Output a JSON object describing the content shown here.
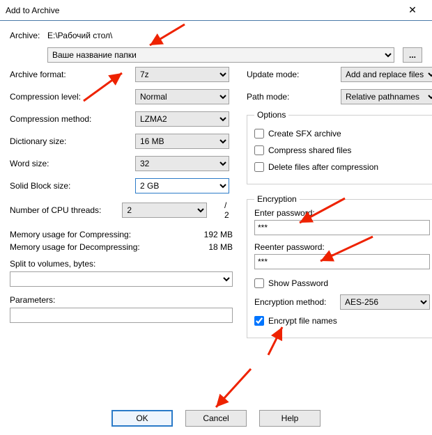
{
  "window": {
    "title": "Add to Archive"
  },
  "archive": {
    "label": "Archive:",
    "path": "E:\\Рабочий стол\\",
    "name": "Ваше название папки",
    "browse": "..."
  },
  "left": {
    "format": {
      "label": "Archive format:",
      "value": "7z"
    },
    "level": {
      "label": "Compression level:",
      "value": "Normal"
    },
    "method": {
      "label": "Compression method:",
      "value": "LZMA2"
    },
    "dict": {
      "label": "Dictionary size:",
      "value": "16 MB"
    },
    "word": {
      "label": "Word size:",
      "value": "32"
    },
    "block": {
      "label": "Solid Block size:",
      "value": "2 GB"
    },
    "threads": {
      "label": "Number of CPU threads:",
      "value": "2",
      "total": "/ 2"
    },
    "mem_comp": {
      "label": "Memory usage for Compressing:",
      "value": "192 MB"
    },
    "mem_decomp": {
      "label": "Memory usage for Decompressing:",
      "value": "18 MB"
    },
    "split": {
      "label": "Split to volumes, bytes:"
    },
    "params": {
      "label": "Parameters:"
    }
  },
  "right": {
    "update": {
      "label": "Update mode:",
      "value": "Add and replace files"
    },
    "path": {
      "label": "Path mode:",
      "value": "Relative pathnames"
    },
    "options": {
      "legend": "Options",
      "sfx": "Create SFX archive",
      "shared": "Compress shared files",
      "delete": "Delete files after compression"
    },
    "encryption": {
      "legend": "Encryption",
      "enter": "Enter password:",
      "reenter": "Reenter password:",
      "pw_value": "***",
      "show": "Show Password",
      "method_label": "Encryption method:",
      "method_value": "AES-256",
      "names": "Encrypt file names"
    }
  },
  "buttons": {
    "ok": "OK",
    "cancel": "Cancel",
    "help": "Help"
  }
}
